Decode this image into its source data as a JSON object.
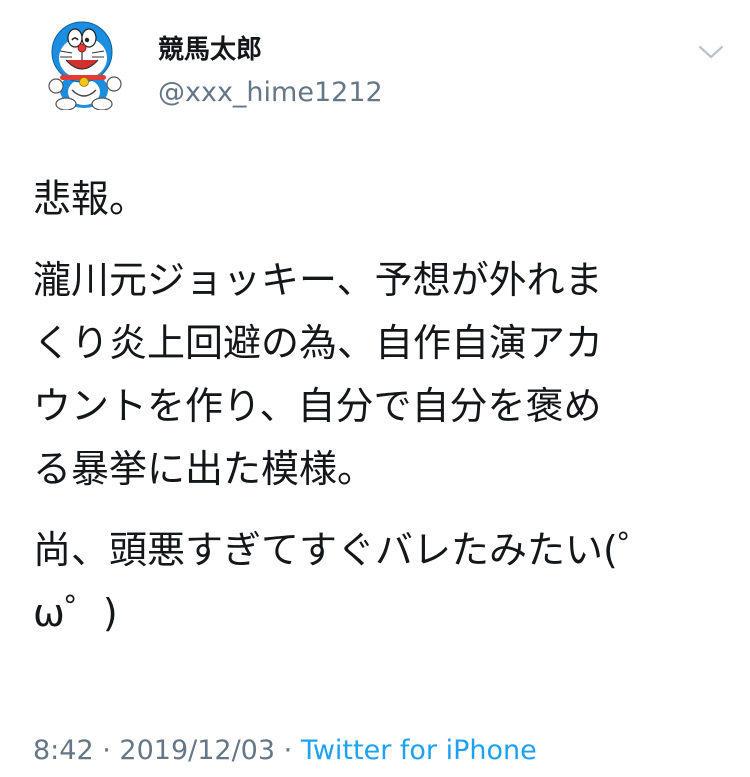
{
  "user": {
    "display_name": "競馬太郎",
    "handle": "@xxx_hime1212"
  },
  "tweet": {
    "paragraphs": [
      "悲報。",
      "瀧川元ジョッキー、予想が外れま\nくり炎上回避の為、自作自演アカ\nウントを作り、自分で自分を褒め\nる暴挙に出た模様。",
      "尚、頭悪すぎてすぐバレたみたい(゜\nω゜)"
    ]
  },
  "meta": {
    "time": "8:42",
    "separator": "·",
    "date": "2019/12/03",
    "source": "Twitter for iPhone"
  },
  "icons": {
    "avatar": "doraemon-avatar",
    "caret": "chevron-down-icon"
  },
  "colors": {
    "text": "#14171a",
    "secondary": "#657786",
    "link": "#1da1f2",
    "doraemon_blue": "#1b8ee0"
  }
}
